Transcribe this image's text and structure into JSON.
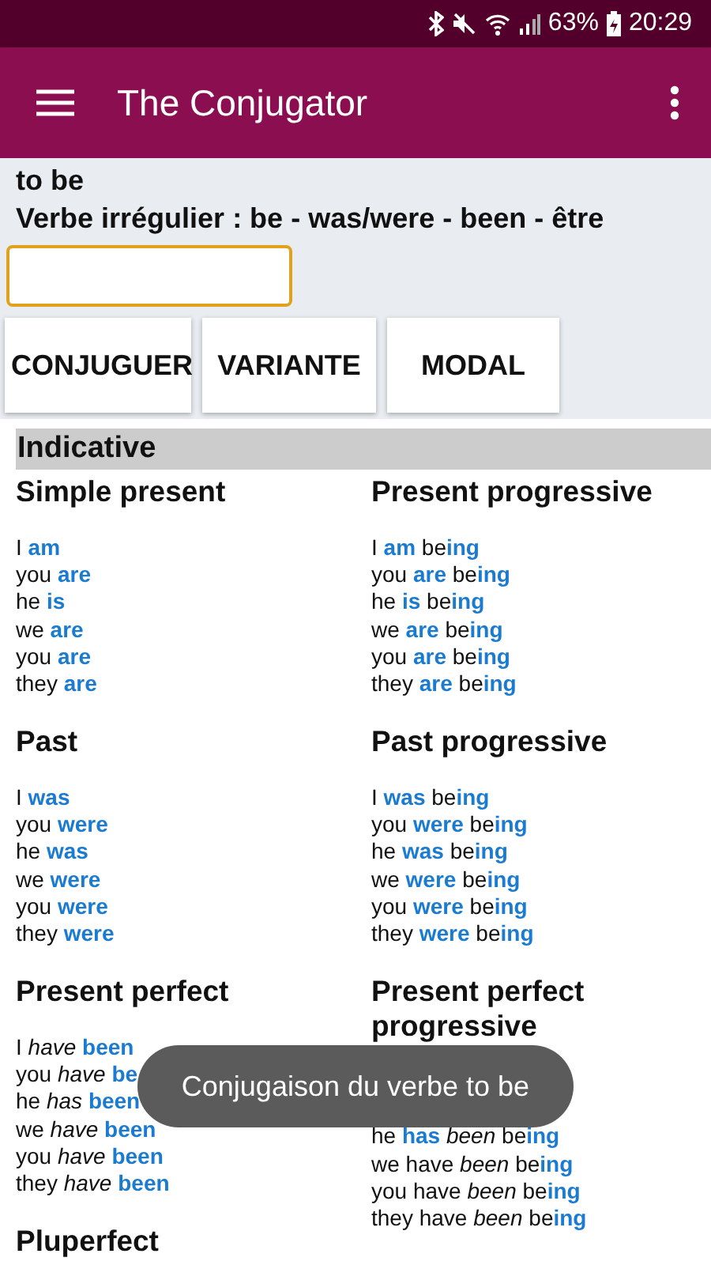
{
  "status_bar": {
    "battery": "63%",
    "time": "20:29"
  },
  "app_bar": {
    "title": "The Conjugator"
  },
  "verb": {
    "title": "to be",
    "info": "Verbe irrégulier : be - was/were - been - être"
  },
  "buttons": [
    "CONJUGUER",
    "VARIANTE",
    "MODAL"
  ],
  "section": {
    "title": "Indicative",
    "tenses": [
      {
        "title": "Simple present",
        "lines": [
          "I **am**",
          "you **are**",
          "he **is**",
          "we **are**",
          "you **are**",
          "they **are**"
        ]
      },
      {
        "title": "Present progressive",
        "lines": [
          "I **am** be**ing**",
          "you **are** be**ing**",
          "he **is** be**ing**",
          "we **are** be**ing**",
          "you **are** be**ing**",
          "they **are** be**ing**"
        ]
      },
      {
        "title": "Past",
        "lines": [
          "I **was**",
          "you **were**",
          "he **was**",
          "we **were**",
          "you **were**",
          "they **were**"
        ]
      },
      {
        "title": "Past progressive",
        "lines": [
          "I **was** be**ing**",
          "you **were** be**ing**",
          "he **was** be**ing**",
          "we **were** be**ing**",
          "you **were** be**ing**",
          "they **were** be**ing**"
        ]
      },
      {
        "title": "Present perfect",
        "lines": [
          "I *have* **been**",
          "you *have* **be**",
          "he *has* **been**",
          "we *have* **been**",
          "you *have* **been**",
          "they *have* **been**"
        ]
      },
      {
        "title": "Present perfect progressive",
        "lines": [
          "he **has** *been* be**ing**",
          "we have *been* be**ing**",
          "you have *been* be**ing**",
          "they have *been* be**ing**"
        ]
      },
      {
        "title": "Pluperfect"
      }
    ]
  },
  "toast": {
    "text": "Conjugaison du verbe to be"
  }
}
